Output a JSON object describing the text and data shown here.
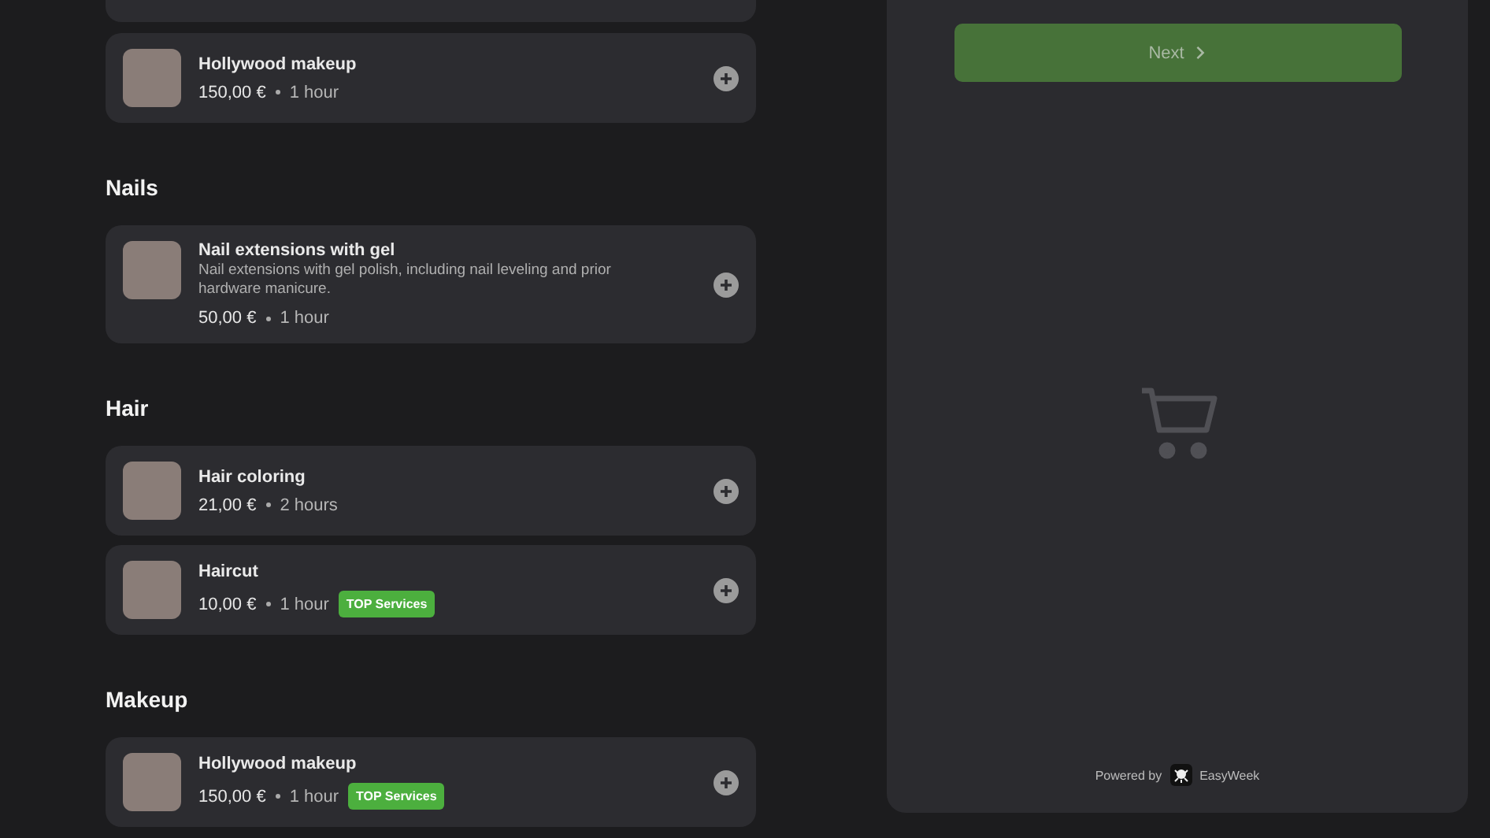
{
  "sections": [
    {
      "services": [
        {
          "name": "Hollywood makeup",
          "price": "150,00 €",
          "duration": "1 hour"
        }
      ]
    },
    {
      "title": "Nails",
      "services": [
        {
          "name": "Nail extensions with gel",
          "description": "Nail extensions with gel polish, including nail leveling and prior hardware manicure.",
          "price": "50,00 €",
          "duration": "1 hour"
        }
      ]
    },
    {
      "title": "Hair",
      "services": [
        {
          "name": "Hair coloring",
          "price": "21,00 €",
          "duration": "2 hours"
        },
        {
          "name": "Haircut",
          "price": "10,00 €",
          "duration": "1 hour",
          "badge": "TOP Services"
        }
      ]
    },
    {
      "title": "Makeup",
      "services": [
        {
          "name": "Hollywood makeup",
          "price": "150,00 €",
          "duration": "1 hour",
          "badge": "TOP Services"
        }
      ]
    }
  ],
  "cart": {
    "next_button": {
      "label": "Next",
      "disabled": true
    },
    "powered_by": "Powered by",
    "brand": "EasyWeek"
  }
}
